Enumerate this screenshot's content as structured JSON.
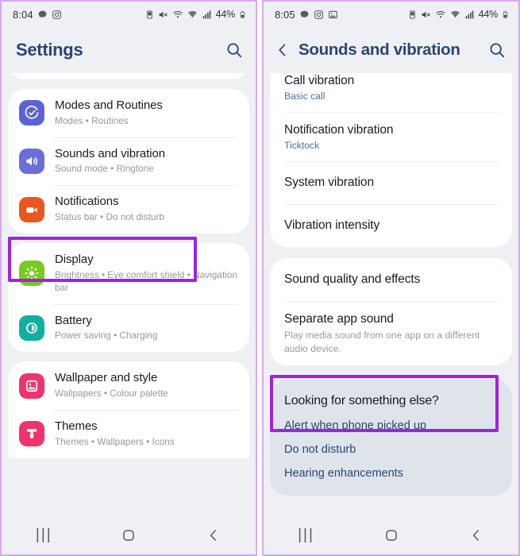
{
  "left_panel": {
    "status_bar": {
      "time": "8:04",
      "left_icons": [
        "chat-bubble-icon",
        "instagram-icon"
      ],
      "right_icons": [
        "alarm-icon",
        "mute-icon",
        "wifi-calling-icon",
        "wifi-icon",
        "signal-bars-icon"
      ],
      "battery_percent": "44%"
    },
    "app_bar": {
      "title": "Settings",
      "search_icon": "search-icon"
    },
    "groups": [
      {
        "rows": [
          {
            "title": "Modes and Routines",
            "subtitle": "Modes  •  Routines",
            "icon": "modes-routines-icon",
            "icon_color": "#5b62d6"
          },
          {
            "title": "Sounds and vibration",
            "subtitle": "Sound mode  •  Ringtone",
            "icon": "speaker-icon",
            "icon_color": "#6a6fd8",
            "highlighted": true
          },
          {
            "title": "Notifications",
            "subtitle": "Status bar  •  Do not disturb",
            "icon": "notifications-icon",
            "icon_color": "#e8571d"
          }
        ]
      },
      {
        "rows": [
          {
            "title": "Display",
            "subtitle": "Brightness  •  Eye comfort shield  •  Navigation bar",
            "icon": "brightness-icon",
            "icon_color": "#7ac922"
          },
          {
            "title": "Battery",
            "subtitle": "Power saving  •  Charging",
            "icon": "battery-icon",
            "icon_color": "#10b0a0"
          }
        ]
      },
      {
        "rows": [
          {
            "title": "Wallpaper and style",
            "subtitle": "Wallpapers  •  Colour palette",
            "icon": "wallpaper-icon",
            "icon_color": "#f0336c"
          },
          {
            "title": "Themes",
            "subtitle": "Themes  •  Wallpapers  •  Icons",
            "icon": "themes-brush-icon",
            "icon_color": "#f0336c"
          }
        ]
      }
    ],
    "nav_bar": {
      "recents": "recents-icon",
      "home": "home-icon",
      "back": "back-icon"
    }
  },
  "right_panel": {
    "status_bar": {
      "time": "8:05",
      "left_icons": [
        "chat-bubble-icon",
        "instagram-icon",
        "gallery-icon"
      ],
      "right_icons": [
        "alarm-icon",
        "mute-icon",
        "wifi-calling-icon",
        "wifi-icon",
        "signal-bars-icon"
      ],
      "battery_percent": "44%"
    },
    "app_bar": {
      "back_icon": "back-chevron-icon",
      "title": "Sounds and vibration",
      "search_icon": "search-icon"
    },
    "vibration_card": {
      "rows": [
        {
          "title": "Call vibration",
          "subtitle": "Basic call",
          "subtitle_style": "link"
        },
        {
          "title": "Notification vibration",
          "subtitle": "Ticktock",
          "subtitle_style": "link"
        },
        {
          "title": "System vibration",
          "subtitle": ""
        },
        {
          "title": "Vibration intensity",
          "subtitle": ""
        }
      ]
    },
    "sound_card": {
      "rows": [
        {
          "title": "Sound quality and effects",
          "subtitle": ""
        },
        {
          "title": "Separate app sound",
          "subtitle": "Play media sound from one app on a different audio device.",
          "subtitle_style": "muted",
          "highlighted": true
        }
      ]
    },
    "suggestions": {
      "heading": "Looking for something else?",
      "links": [
        "Alert when phone picked up",
        "Do not disturb",
        "Hearing enhancements"
      ]
    },
    "nav_bar": {
      "recents": "recents-icon",
      "home": "home-icon",
      "back": "back-icon"
    }
  },
  "theme": {
    "highlight_color": "#a020e8",
    "frame_border": "#d9a8ef",
    "title_color": "#2a4673",
    "page_background": "#eef0f3",
    "card_background": "#ffffff",
    "suggest_background": "#dfe4ea"
  }
}
